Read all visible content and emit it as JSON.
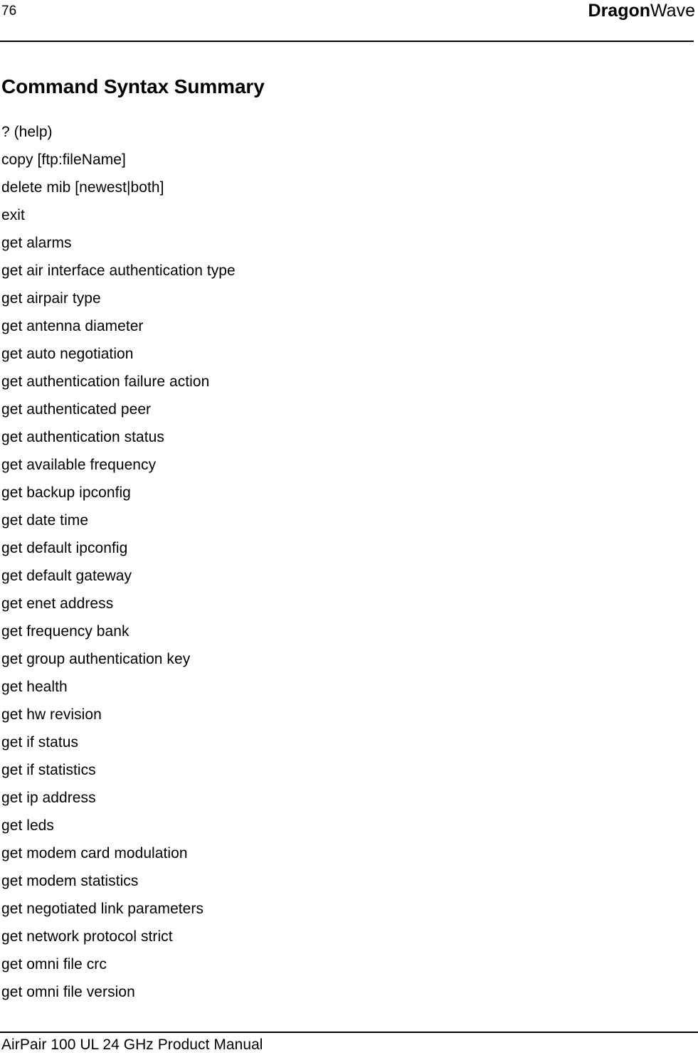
{
  "header": {
    "page_number": "76",
    "brand_bold": "Dragon",
    "brand_regular": "Wave"
  },
  "section": {
    "title": "Command Syntax Summary"
  },
  "commands": [
    "? (help)",
    "copy [ftp:fileName]",
    "delete mib [newest|both]",
    "exit",
    "get alarms",
    "get air interface authentication type",
    "get airpair type",
    "get antenna diameter",
    "get auto negotiation",
    "get authentication failure action",
    "get authenticated peer",
    "get authentication status",
    "get available frequency",
    "get backup ipconfig",
    "get date time",
    "get default ipconfig",
    "get default gateway",
    "get enet address",
    "get frequency bank",
    "get group authentication key",
    "get health",
    "get hw revision",
    "get if status",
    "get if statistics",
    "get ip address",
    "get leds",
    "get modem card modulation",
    "get modem statistics",
    "get negotiated link parameters",
    "get network protocol strict",
    "get omni file crc",
    "get omni file version"
  ],
  "footer": {
    "text": "AirPair 100 UL 24 GHz Product Manual"
  }
}
